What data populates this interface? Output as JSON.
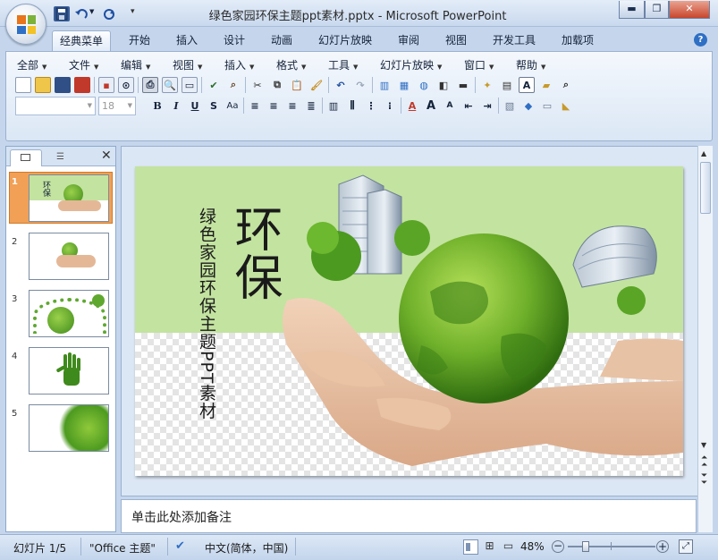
{
  "window": {
    "title": "绿色家园环保主题ppt素材.pptx - Microsoft PowerPoint",
    "controls": [
      "minimize",
      "maximize",
      "close"
    ]
  },
  "ribbon_tabs": [
    {
      "label": "经典菜单",
      "active": true
    },
    {
      "label": "开始"
    },
    {
      "label": "插入"
    },
    {
      "label": "设计"
    },
    {
      "label": "动画"
    },
    {
      "label": "幻灯片放映"
    },
    {
      "label": "审阅"
    },
    {
      "label": "视图"
    },
    {
      "label": "开发工具"
    },
    {
      "label": "加载项"
    }
  ],
  "menus": [
    "全部",
    "文件",
    "编辑",
    "视图",
    "插入",
    "格式",
    "工具",
    "幻灯片放映",
    "窗口",
    "帮助"
  ],
  "format": {
    "font_name": "",
    "font_size": "18",
    "bold": "B",
    "italic": "I",
    "underline": "U",
    "shadow": "S",
    "char_spacing": "Aa",
    "text_box_letter": "A"
  },
  "pane_tabs": [
    "slides",
    "outline"
  ],
  "thumbnails": [
    {
      "num": "1",
      "selected": true,
      "mini_text": "环保"
    },
    {
      "num": "2"
    },
    {
      "num": "3"
    },
    {
      "num": "4"
    },
    {
      "num": "5"
    }
  ],
  "slide": {
    "title": "环保",
    "subtitle": "绿色家园环保主题PPT素材",
    "top_color": "#c3e3a0"
  },
  "notes_placeholder": "单击此处添加备注",
  "status": {
    "slide_info": "幻灯片 1/5",
    "theme": "\"Office 主题\"",
    "language": "中文(简体，中国)",
    "zoom": "48%"
  },
  "colors": {
    "accent_green": "#5fa830",
    "office_orange": "#e8741c",
    "chrome_blue": "#c5d6ec"
  }
}
